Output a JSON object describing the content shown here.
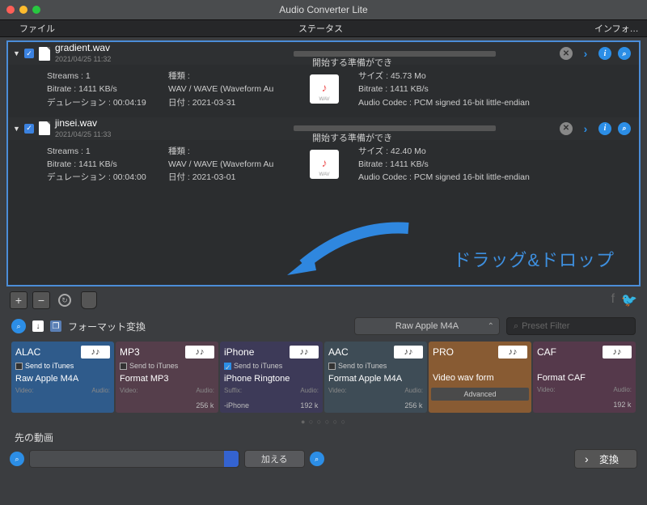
{
  "window": {
    "title": "Audio Converter Lite"
  },
  "headers": {
    "file": "ファイル",
    "status": "ステータス",
    "info": "インフォ…"
  },
  "files": [
    {
      "name": "gradient.wav",
      "date": "2021/04/25 11:32",
      "status": "開始する準備ができ",
      "streams": "Streams : 1",
      "bitrate": "Bitrate : 1411 KB/s",
      "duration": "デュレーション : 00:04:19",
      "kind_lbl": "種類 :",
      "kind": "WAV / WAVE (Waveform Au",
      "date_lbl": "日付 : 2021-03-31",
      "size": "サイズ : 45.73 Mo",
      "br2": "Bitrate : 1411 KB/s",
      "codec": "Audio Codec : PCM signed 16-bit little-endian",
      "thumb": "WAV"
    },
    {
      "name": "jinsei.wav",
      "date": "2021/04/25 11:33",
      "status": "開始する準備ができ",
      "streams": "Streams : 1",
      "bitrate": "Bitrate : 1411 KB/s",
      "duration": "デュレーション : 00:04:00",
      "kind_lbl": "種類 :",
      "kind": "WAV / WAVE (Waveform Au",
      "date_lbl": "日付 : 2021-03-01",
      "size": "サイズ : 42.40 Mo",
      "br2": "Bitrate : 1411 KB/s",
      "codec": "Audio Codec : PCM signed 16-bit little-endian",
      "thumb": "WAV"
    }
  ],
  "dragdrop": "ドラッグ&ドロップ",
  "mid": {
    "label": "フォーマット変換",
    "select": "Raw Apple M4A",
    "search_ph": "Preset Filter"
  },
  "cards": [
    {
      "fmt": "ALAC",
      "sti": "Send to iTunes",
      "title": "Raw Apple M4A",
      "p1": "Video:",
      "p2": "Audio:",
      "v1": "",
      "v2": ""
    },
    {
      "fmt": "MP3",
      "sti": "Send to iTunes",
      "title": "Format MP3",
      "p1": "Video:",
      "p2": "Audio:",
      "v1": "",
      "v2": "256   k"
    },
    {
      "fmt": "iPhone",
      "sti": "Send to iTunes",
      "title": "iPhone Ringtone",
      "p1": "Suffix:",
      "p2": "Audio:",
      "v1": "-iPhone",
      "v2": "192   k"
    },
    {
      "fmt": "AAC",
      "sti": "Send to iTunes",
      "title": "Format Apple M4A",
      "p1": "Video:",
      "p2": "Audio:",
      "v1": "",
      "v2": "256   k"
    },
    {
      "fmt": "PRO",
      "sti": "",
      "title": "Video wav form",
      "adv": "Advanced"
    },
    {
      "fmt": "CAF",
      "sti": "",
      "title": "Format CAF",
      "p1": "Video:",
      "p2": "Audio:",
      "v1": "",
      "v2": "192   k"
    }
  ],
  "bottom": {
    "label": "先の動画",
    "add": "加える",
    "convert": "変換"
  }
}
